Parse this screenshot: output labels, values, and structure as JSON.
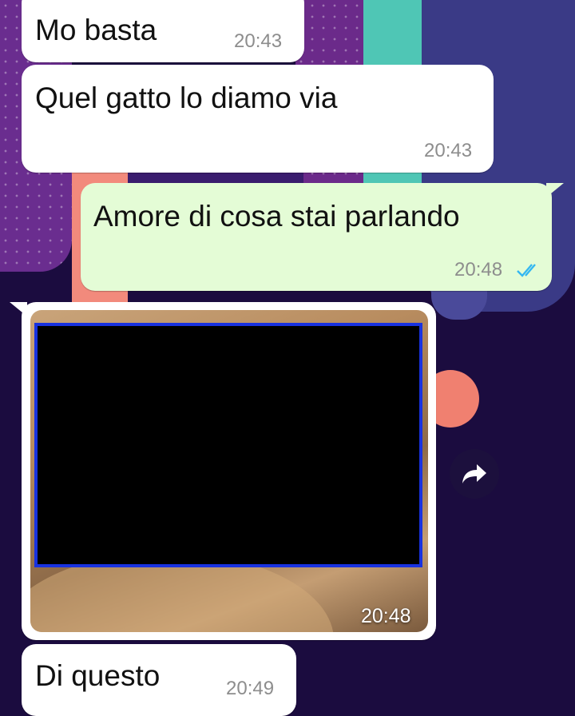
{
  "messages": [
    {
      "direction": "incoming",
      "text": "Mo basta",
      "time": "20:43"
    },
    {
      "direction": "incoming",
      "text": "Quel gatto lo diamo via",
      "time": "20:43"
    },
    {
      "direction": "outgoing",
      "text": "Amore di cosa stai parlando",
      "time": "20:48",
      "status": "read"
    },
    {
      "direction": "incoming",
      "type": "image",
      "time": "20:48",
      "image_content": "censored"
    },
    {
      "direction": "incoming",
      "text": "Di questo",
      "time": "20:49"
    }
  ],
  "icons": {
    "read_receipt": "double-check-icon",
    "forward": "forward-arrow-icon"
  },
  "colors": {
    "incoming_bubble": "#ffffff",
    "outgoing_bubble": "#e4fcd6",
    "read_ticks": "#34b7f1",
    "timestamp": "#8d8d8d",
    "censor_fill": "#000000",
    "censor_border": "#1832e0",
    "wallpaper_base": "#1b0c3f"
  }
}
